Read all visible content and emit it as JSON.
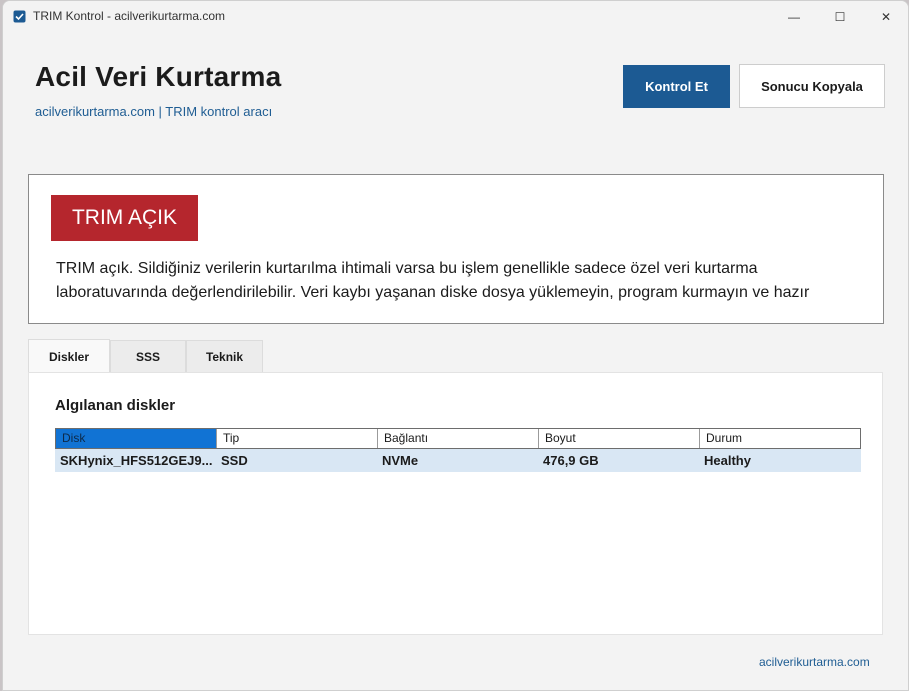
{
  "window": {
    "title": "TRIM Kontrol - acilverikurtarma.com",
    "minimize_glyph": "—",
    "maximize_glyph": "☐",
    "close_glyph": "✕"
  },
  "header": {
    "title": "Acil Veri Kurtarma",
    "subtitle": "acilverikurtarma.com | TRIM kontrol aracı",
    "check_button": "Kontrol Et",
    "copy_button": "Sonucu Kopyala"
  },
  "status": {
    "badge": "TRIM AÇIK",
    "badge_color": "#b5262d",
    "line1": "TRIM açık. Sildiğiniz verilerin kurtarılma ihtimali varsa bu işlem genellikle sadece özel veri kurtarma",
    "line2": "laboratuvarında değerlendirilebilir. Veri kaybı yaşanan diske dosya yüklemeyin, program kurmayın ve hazır"
  },
  "tabs": [
    {
      "label": "Diskler"
    },
    {
      "label": "SSS"
    },
    {
      "label": "Teknik"
    }
  ],
  "disks": {
    "title": "Algılanan diskler",
    "columns": [
      "Disk",
      "Tip",
      "Bağlantı",
      "Boyut",
      "Durum"
    ],
    "rows": [
      [
        "SKHynix_HFS512GEJ9...",
        "SSD",
        "NVMe",
        "476,9 GB",
        "Healthy"
      ]
    ]
  },
  "footer": {
    "link": "acilverikurtarma.com"
  },
  "colors": {
    "accent": "#1c5a93",
    "link": "#1f5d93",
    "selected_header": "#1173d4",
    "row_highlight": "#d9e7f4"
  }
}
